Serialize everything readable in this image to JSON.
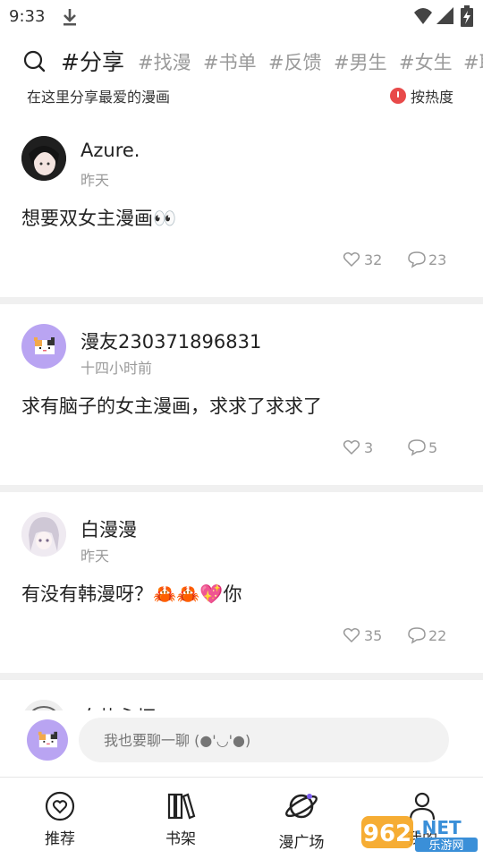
{
  "status_bar": {
    "time": "9:33"
  },
  "topics": {
    "active": "#分享",
    "items": [
      "#找漫",
      "#书单",
      "#反馈",
      "#男生",
      "#女生",
      "#耶"
    ]
  },
  "header": {
    "description": "在这里分享最爱的漫画",
    "sort_label": "按热度"
  },
  "posts": [
    {
      "author": "Azure.",
      "time": "昨天",
      "content": "想要双女主漫画👀",
      "likes": "32",
      "comments": "23"
    },
    {
      "author": "漫友230371896831",
      "time": "十四小时前",
      "content": "求有脑子的女主漫画，求求了求求了",
      "likes": "3",
      "comments": "5"
    },
    {
      "author": "白漫漫",
      "time": "昨天",
      "content": "有没有韩漫呀？🦀🦀💖你",
      "likes": "35",
      "comments": "22"
    },
    {
      "author": "白热永恒"
    }
  ],
  "comment_bar": {
    "placeholder": "我也要聊一聊 (●'◡'●)"
  },
  "bottom_nav": {
    "items": [
      "推荐",
      "书架",
      "漫广场",
      "我的"
    ]
  },
  "watermark": {
    "brand": "962",
    "net": ".NET",
    "sub": "乐游网"
  },
  "colors": {
    "accent_red": "#e84a4a",
    "avatar_purple": "#b9a4f2",
    "muted": "#9a9a9a"
  }
}
